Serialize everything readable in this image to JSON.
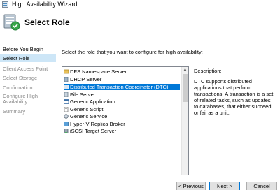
{
  "window": {
    "title": "High Availability Wizard",
    "icon": "cluster-wizard-icon"
  },
  "header": {
    "heading": "Select Role",
    "icon": "select-role-icon"
  },
  "nav": {
    "items": [
      {
        "label": "Before You Begin",
        "state": "completed"
      },
      {
        "label": "Select Role",
        "state": "active"
      },
      {
        "label": "Client Access Point",
        "state": "disabled"
      },
      {
        "label": "Select Storage",
        "state": "disabled"
      },
      {
        "label": "Confirmation",
        "state": "disabled"
      },
      {
        "label": "Configure High Availability",
        "state": "disabled"
      },
      {
        "label": "Summary",
        "state": "disabled"
      }
    ]
  },
  "main": {
    "instruction": "Select the role that you want to configure for high availability:",
    "roles": [
      {
        "label": "DFS Namespace Server",
        "icon": "dfs-namespace-icon",
        "selected": false
      },
      {
        "label": "DHCP Server",
        "icon": "dhcp-server-icon",
        "selected": false
      },
      {
        "label": "Distributed Transaction Coordinator (DTC)",
        "icon": "dtc-icon",
        "selected": true
      },
      {
        "label": "File Server",
        "icon": "file-server-icon",
        "selected": false
      },
      {
        "label": "Generic Application",
        "icon": "generic-application-icon",
        "selected": false
      },
      {
        "label": "Generic Script",
        "icon": "generic-script-icon",
        "selected": false
      },
      {
        "label": "Generic Service",
        "icon": "generic-service-icon",
        "selected": false
      },
      {
        "label": "Hyper-V Replica Broker",
        "icon": "hyperv-replica-broker-icon",
        "selected": false
      },
      {
        "label": "iSCSI Target Server",
        "icon": "iscsi-target-icon",
        "selected": false
      }
    ],
    "description_label": "Description:",
    "description_text": "DTC supports distributed applications that perform transactions. A transaction is a set of related tasks, such as updates to databases, that either succeed or fail as a unit."
  },
  "footer": {
    "previous_label": "< Previous",
    "next_label": "Next >",
    "cancel_label": "Cancel"
  },
  "colors": {
    "selection": "#0078d7",
    "nav_active": "#cde6f7",
    "nav_disabled": "#8a8a8a"
  }
}
